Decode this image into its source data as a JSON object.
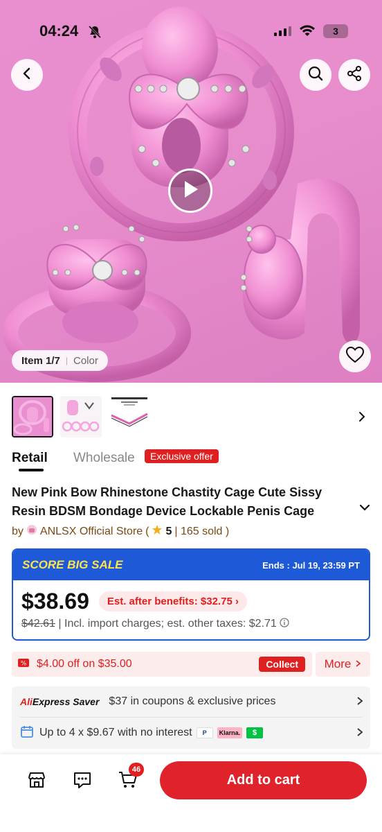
{
  "status_bar": {
    "time": "04:24",
    "battery": "3",
    "icons": [
      "bell-slash-icon",
      "signal-icon",
      "wifi-icon",
      "battery-icon"
    ]
  },
  "gallery": {
    "item_label": "Item 1/7",
    "separator": "|",
    "color_label": "Color",
    "icons": [
      "back-icon",
      "search-icon",
      "share-icon",
      "play-icon",
      "heart-icon"
    ]
  },
  "thumbnails": [
    {
      "name": "thumbnail-1",
      "selected": true
    },
    {
      "name": "thumbnail-2",
      "selected": false
    },
    {
      "name": "thumbnail-3",
      "selected": false
    }
  ],
  "tabs": {
    "retail": "Retail",
    "wholesale": "Wholesale",
    "exclusive_badge": "Exclusive offer"
  },
  "product": {
    "title": "New Pink Bow Rhinestone Chastity Cage Cute Sissy Resin BDSM Bondage Device Lockable Penis Cage Beginner Fr",
    "store_prefix": "by",
    "store_name": "ANLSX Official Store",
    "rating_open": "(",
    "rating": "5",
    "sold": "| 165 sold )"
  },
  "sale": {
    "name": "SCORE BIG SALE",
    "ends": "Ends : Jul 19, 23:59 PT",
    "price": "$38.69",
    "benefit": "Est. after benefits: $32.75",
    "original_price": "$42.61",
    "charges": "| Incl. import charges; est. other taxes: $2.71"
  },
  "coupon": {
    "text": "$4.00 off on $35.00",
    "collect": "Collect",
    "more": "More"
  },
  "saver": {
    "logo_a": "Ali",
    "logo_b": "Express",
    "logo_c": " Saver",
    "text": "$37 in coupons & exclusive prices"
  },
  "installment": {
    "text": "Up to 4 x $9.67 with no interest",
    "methods": [
      "P",
      "Klarna.",
      "$"
    ]
  },
  "bottom_bar": {
    "cart_count": "46",
    "add_to_cart": "Add to cart"
  },
  "colors": {
    "accent": "#e0232b",
    "sale_blue": "#1e5ad8",
    "sale_yellow": "#ffe34d",
    "hero_pink": "#e78dcc"
  }
}
